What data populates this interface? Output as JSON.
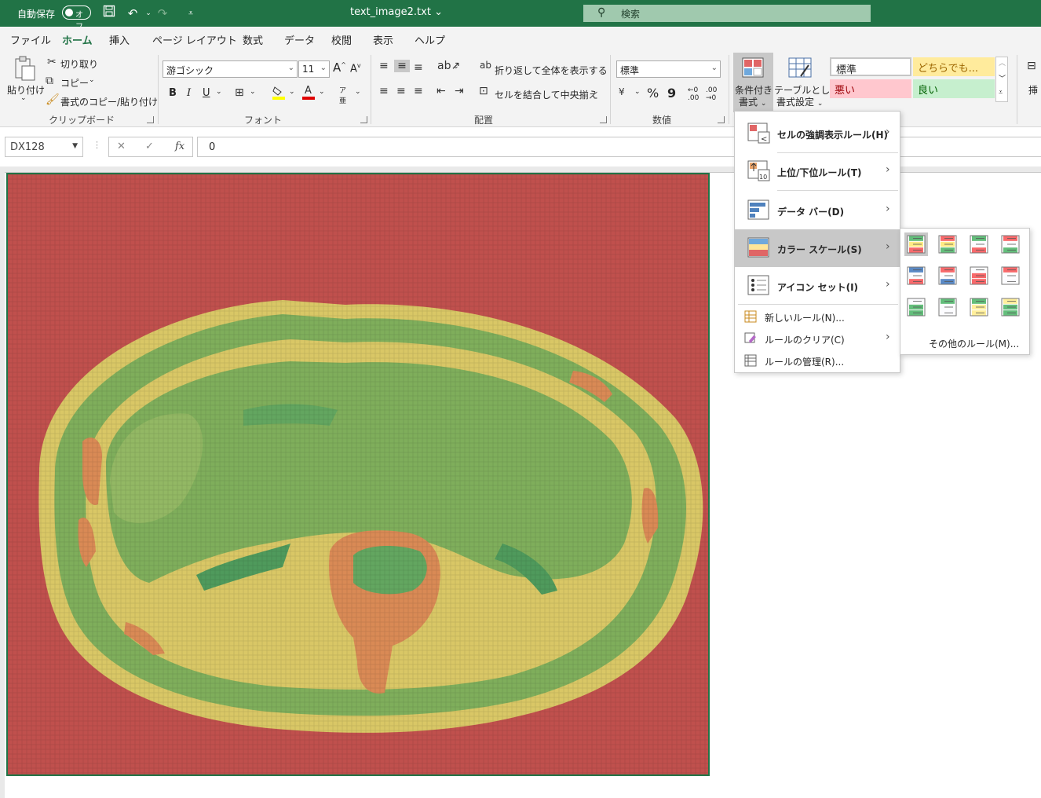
{
  "titlebar": {
    "autosave": "自動保存",
    "toggle": "オフ",
    "filename": "text_image2.txt",
    "search": "検索"
  },
  "tabs": [
    "ファイル",
    "ホーム",
    "挿入",
    "ページ レイアウト",
    "数式",
    "データ",
    "校閲",
    "表示",
    "ヘルプ"
  ],
  "active_tab": "ホーム",
  "ribbon": {
    "clipboard": {
      "paste": "貼り付け",
      "cut": "切り取り",
      "copy": "コピー",
      "format_painter": "書式のコピー/貼り付け",
      "label": "クリップボード"
    },
    "font": {
      "name": "游ゴシック",
      "size": "11",
      "bold": "B",
      "italic": "I",
      "underline": "U",
      "grow": "A",
      "shrink": "A",
      "font_color": "A",
      "phonetic": "ア",
      "label": "フォント"
    },
    "alignment": {
      "wrap": "折り返して全体を表示する",
      "merge": "セルを結合して中央揃え",
      "label": "配置"
    },
    "number": {
      "format": "標準",
      "percent": "%",
      "comma": "9",
      "label": "数値"
    },
    "cond_format": {
      "line1": "条件付き",
      "line2": "書式"
    },
    "table_format": {
      "line1": "テーブルとして",
      "line2": "書式設定"
    },
    "styles": {
      "normal": "標準",
      "neutral": "どちらでも...",
      "bad": "悪い",
      "good": "良い"
    },
    "insert": "挿"
  },
  "formula_bar": {
    "name_box": "DX128",
    "cancel": "✕",
    "enter": "✓",
    "fx": "fx",
    "value": "0"
  },
  "menu": {
    "highlight_rules": "セルの強調表示ルール(H)",
    "top_bottom": "上位/下位ルール(T)",
    "data_bar": "データ バー(D)",
    "color_scale": "カラー スケール(S)",
    "icon_set": "アイコン セット(I)",
    "new_rule": "新しいルール(N)...",
    "clear_rules": "ルールのクリア(C)",
    "manage_rules": "ルールの管理(R)..."
  },
  "submenu": {
    "more_rules": "その他のルール(M)...",
    "scales": [
      [
        "#63be7b",
        "#ffeb84",
        "#f8696b"
      ],
      [
        "#f8696b",
        "#ffeb84",
        "#63be7b"
      ],
      [
        "#63be7b",
        "#fcfcff",
        "#f8696b"
      ],
      [
        "#f8696b",
        "#fcfcff",
        "#63be7b"
      ],
      [
        "#5a8ac6",
        "#fcfcff",
        "#f8696b"
      ],
      [
        "#f8696b",
        "#fcfcff",
        "#5a8ac6"
      ],
      [
        "#fcfcff",
        "#f8696b",
        "#f8696b"
      ],
      [
        "#f8696b",
        "#fcfcff",
        "#fcfcff"
      ],
      [
        "#fcfcff",
        "#63be7b",
        "#63be7b"
      ],
      [
        "#63be7b",
        "#fcfcff",
        "#fcfcff"
      ],
      [
        "#63be7b",
        "#ffef9c",
        "#ffef9c"
      ],
      [
        "#ffef9c",
        "#63be7b",
        "#63be7b"
      ]
    ]
  },
  "colors": {
    "excel_green": "#217346",
    "heat_red": "#c0504d",
    "heat_yellow": "#d9c766",
    "heat_green": "#7fae5b",
    "heat_dkgreen": "#4f9a5c",
    "heat_orange": "#d98a55"
  }
}
